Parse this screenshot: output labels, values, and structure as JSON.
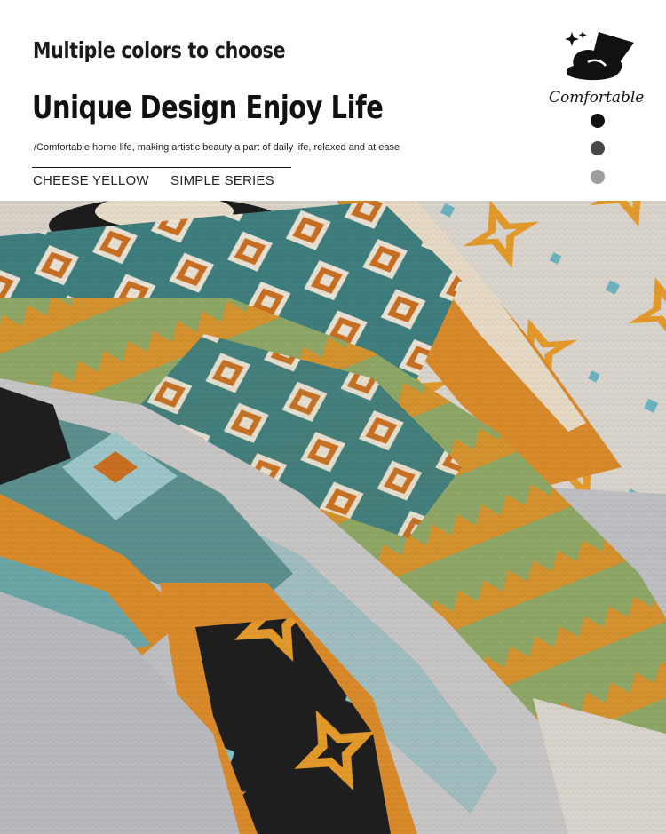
{
  "header": {
    "subtitle": "Multiple colors to choose",
    "title": "Unique Design Enjoy Life",
    "tagline": "/Comfortable home life, making artistic beauty a part of daily life, relaxed and at ease",
    "series_left": "CHEESE YELLOW",
    "series_right": "SIMPLE SERIES"
  },
  "logo": {
    "text": "Comfortable",
    "icon": "hand-holding-blanket-icon"
  },
  "color_options": [
    "#111111",
    "#474747",
    "#9e9e9e"
  ],
  "photo": {
    "icon": "aztec-throw-blankets-photo"
  }
}
